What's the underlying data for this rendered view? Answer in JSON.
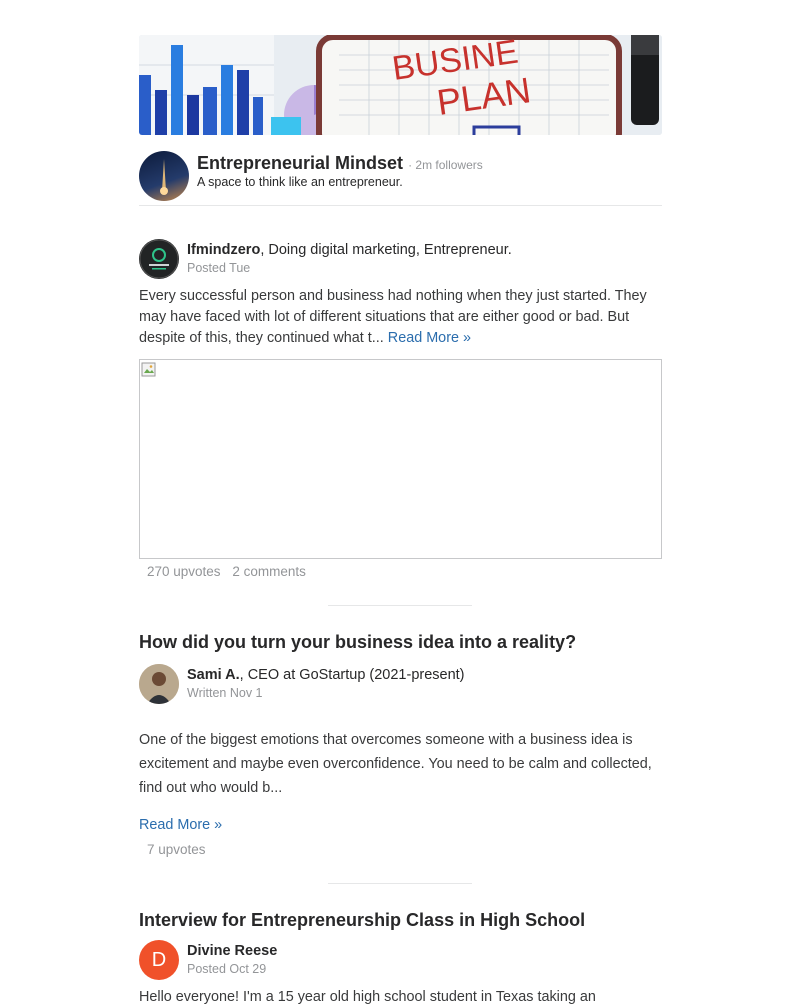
{
  "space": {
    "name": "Entrepreneurial Mindset",
    "followers": "· 2m followers",
    "description": "A space to think like an entrepreneur.",
    "banner_text_line1": "BUSINE",
    "banner_text_line2": "PLAN"
  },
  "posts": [
    {
      "author": "Ifmindzero",
      "credential": ", Doing digital marketing, Entrepreneur.",
      "meta": "Posted Tue",
      "text": "Every successful person and business had nothing when they just started. They may have faced with lot of different situations that are either good or bad. But despite of this, they continued what t...",
      "read_more": "Read More »",
      "upvotes": "270 upvotes",
      "comments": "2 comments"
    },
    {
      "title": "How did you turn your business idea into a reality?",
      "author": "Sami A.",
      "credential": ", CEO at GoStartup (2021-present)",
      "meta": "Written Nov 1",
      "text": "One of the biggest emotions that overcomes someone with a business idea is excitement and maybe even overconfidence. You need to be calm and collected, find out who would b...",
      "read_more": "Read More »",
      "upvotes": "7 upvotes"
    },
    {
      "title": "Interview for Entrepreneurship Class in High School",
      "author": "Divine Reese",
      "avatar_letter": "D",
      "meta": "Posted Oct 29",
      "text": "Hello everyone! I'm a 15 year old high school student in Texas taking an"
    }
  ],
  "colors": {
    "link": "#2b6dad",
    "muted": "#939598",
    "avatar_orange": "#f0512a"
  }
}
